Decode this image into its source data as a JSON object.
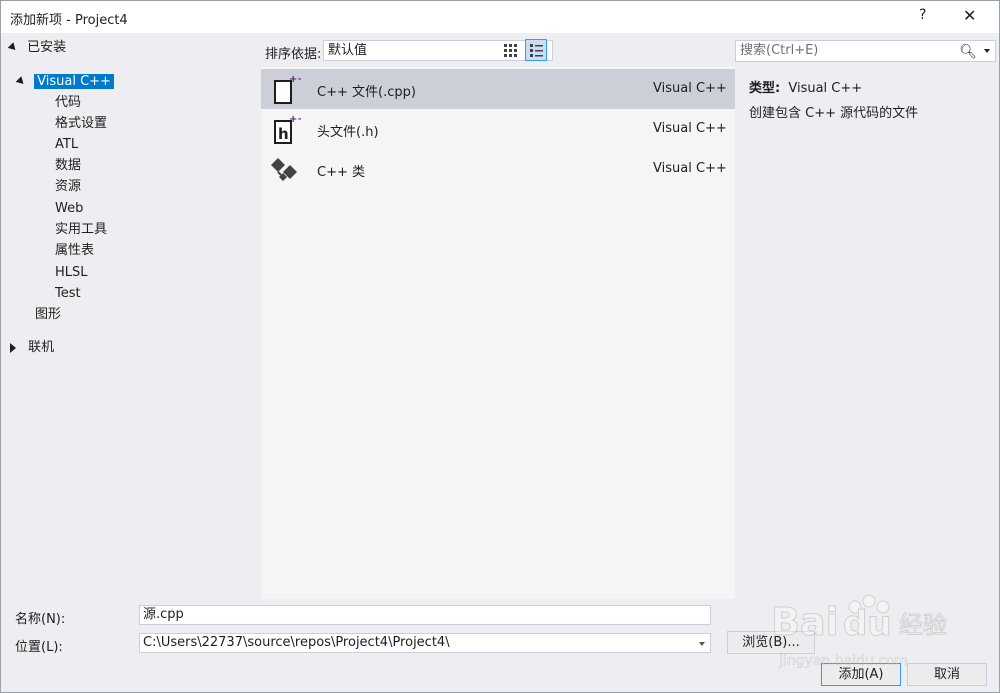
{
  "window": {
    "title": "添加新项 - Project4",
    "help_label": "?",
    "close_label": "✕"
  },
  "tree": {
    "installed": "已安装",
    "visual_cpp": "Visual C++",
    "children": [
      "代码",
      "格式设置",
      "ATL",
      "数据",
      "资源",
      "Web",
      "实用工具",
      "属性表",
      "HLSL",
      "Test"
    ],
    "graphics": "图形",
    "online": "联机"
  },
  "sort": {
    "label": "排序依据:",
    "value": "默认值"
  },
  "search": {
    "placeholder": "搜索(Ctrl+E)"
  },
  "items": [
    {
      "name": "C++ 文件(.cpp)",
      "lang": "Visual C++",
      "icon": "cpp-file-icon",
      "selected": true
    },
    {
      "name": "头文件(.h)",
      "lang": "Visual C++",
      "icon": "header-file-icon",
      "selected": false
    },
    {
      "name": "C++ 类",
      "lang": "Visual C++",
      "icon": "cpp-class-icon",
      "selected": false
    }
  ],
  "details": {
    "type_label": "类型:",
    "type_value": "Visual C++",
    "description": "创建包含 C++ 源代码的文件"
  },
  "form": {
    "name_label": "名称(N):",
    "name_value": "源.cpp",
    "location_label": "位置(L):",
    "location_value": "C:\\Users\\22737\\source\\repos\\Project4\\Project4\\",
    "browse_label": "浏览(B)...",
    "add_label": "添加(A)",
    "cancel_label": "取消"
  },
  "colors": {
    "selection": "#007acc",
    "item_selected": "#ccced8",
    "accent_purple": "#68217a"
  },
  "watermark": {
    "brand": "Baidu",
    "sub": "经验",
    "url": "jingyan.baidu.com"
  }
}
